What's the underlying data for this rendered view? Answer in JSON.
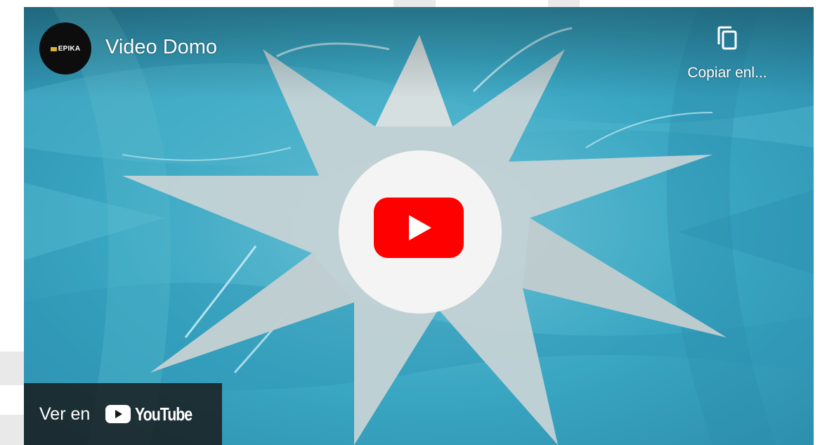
{
  "video": {
    "title": "Video Domo",
    "channel_avatar_text": "EPIKA",
    "channel_avatar_icon": "epika-logo-icon",
    "copy_link_label": "Copiar enl...",
    "copy_link_icon": "copy-icon",
    "play_icon": "youtube-play-icon",
    "watch_on_label": "Ver en",
    "watch_on_brand": "YouTube",
    "colors": {
      "thumbnail_teal": "#3fa9c4",
      "thumbnail_star": "#c8d3d5",
      "youtube_red": "#ff0000",
      "overlay_dark": "#171717"
    }
  }
}
